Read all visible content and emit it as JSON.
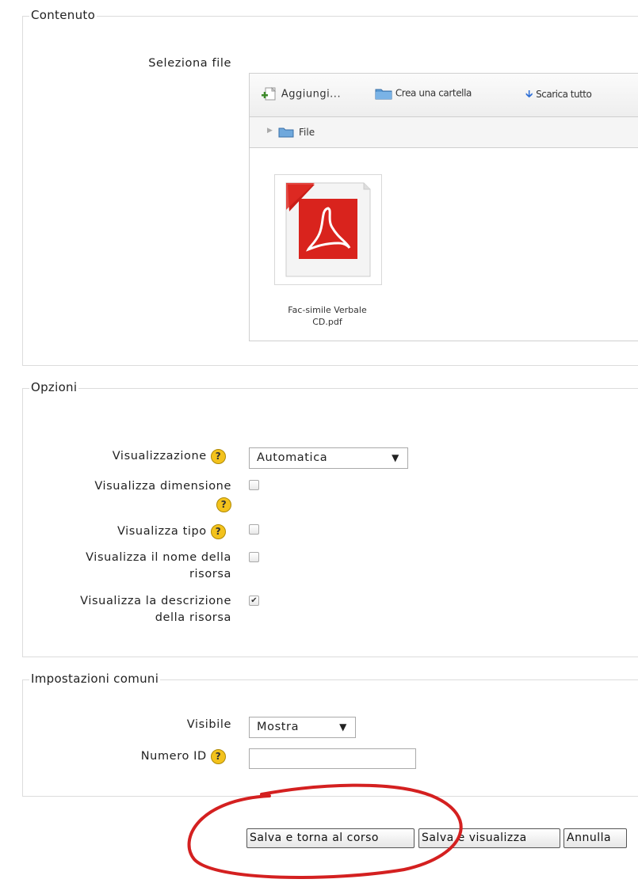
{
  "contenuto": {
    "legend": "Contenuto",
    "select_file_label": "Seleziona file",
    "toolbar": {
      "add_label": "Aggiungi...",
      "new_folder_label": "Crea una cartella",
      "download_all_label": "Scarica tutto"
    },
    "path_label": "File",
    "file": {
      "name_line1": "Fac-simile Verbale",
      "name_line2": "CD.pdf",
      "icon": "pdf-file-icon"
    }
  },
  "opzioni": {
    "legend": "Opzioni",
    "display_label": "Visualizzazione",
    "display_value": "Automatica",
    "show_size_label": "Visualizza dimensione",
    "show_type_label": "Visualizza tipo",
    "show_name_label_1": "Visualizza il nome della",
    "show_name_label_2": "risorsa",
    "show_desc_label_1": "Visualizza la descrizione",
    "show_desc_label_2": "della risorsa",
    "show_size_checked": false,
    "show_type_checked": false,
    "show_name_checked": false,
    "show_desc_checked": true
  },
  "comuni": {
    "legend": "Impostazioni comuni",
    "visible_label": "Visibile",
    "visible_value": "Mostra",
    "id_label": "Numero ID",
    "id_value": ""
  },
  "buttons": {
    "save_return": "Salva e torna al corso",
    "save_show": "Salva e visualizza",
    "cancel": "Annulla"
  },
  "annotation_color": "#d42020",
  "help_icon_glyph": "?",
  "check_glyph": "✔",
  "dropdown_arrow_glyph": "▼"
}
